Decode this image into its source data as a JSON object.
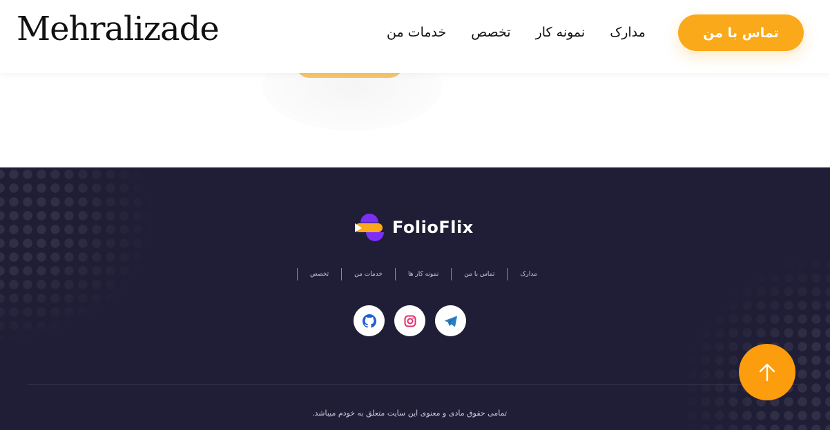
{
  "header": {
    "brand": "Mehralizade",
    "nav": [
      "مدارک",
      "نمونه کار",
      "تخصص",
      "خدمات من"
    ],
    "contact_label": "تماس با من"
  },
  "footer": {
    "logo_text": "FolioFlix",
    "links": [
      "مدارک",
      "تماس با من",
      "نمونه کار ها",
      "خدمات من",
      "تخصص"
    ],
    "socials": [
      "telegram-icon",
      "instagram-icon",
      "github-icon"
    ],
    "copyright": "تمامی حقوق مادی و معنوی این سایت متعلق به خودم میباشد."
  },
  "colors": {
    "accent": "#f9a91a",
    "footer_bg": "#201e36",
    "logo_purple": "#7b2ff7",
    "telegram": "#2a9fd6",
    "instagram": "#e1306c"
  }
}
